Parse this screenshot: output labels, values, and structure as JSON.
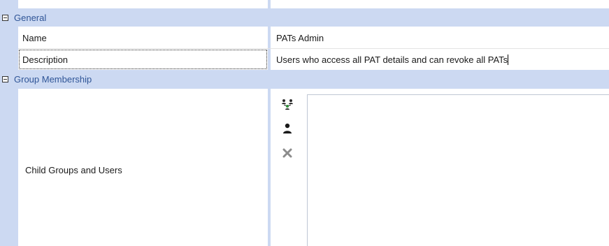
{
  "categories": {
    "general": "General",
    "membership": "Group Membership"
  },
  "properties": {
    "name": {
      "label": "Name",
      "value": "PATs Admin"
    },
    "description": {
      "label": "Description",
      "value": "Users who access all PAT details and can revoke all PATs"
    },
    "child": {
      "label": "Child Groups and Users"
    }
  },
  "toolbar": {
    "add_group_icon": "group-add-icon",
    "add_user_icon": "user-add-icon",
    "remove_icon": "remove-icon"
  }
}
